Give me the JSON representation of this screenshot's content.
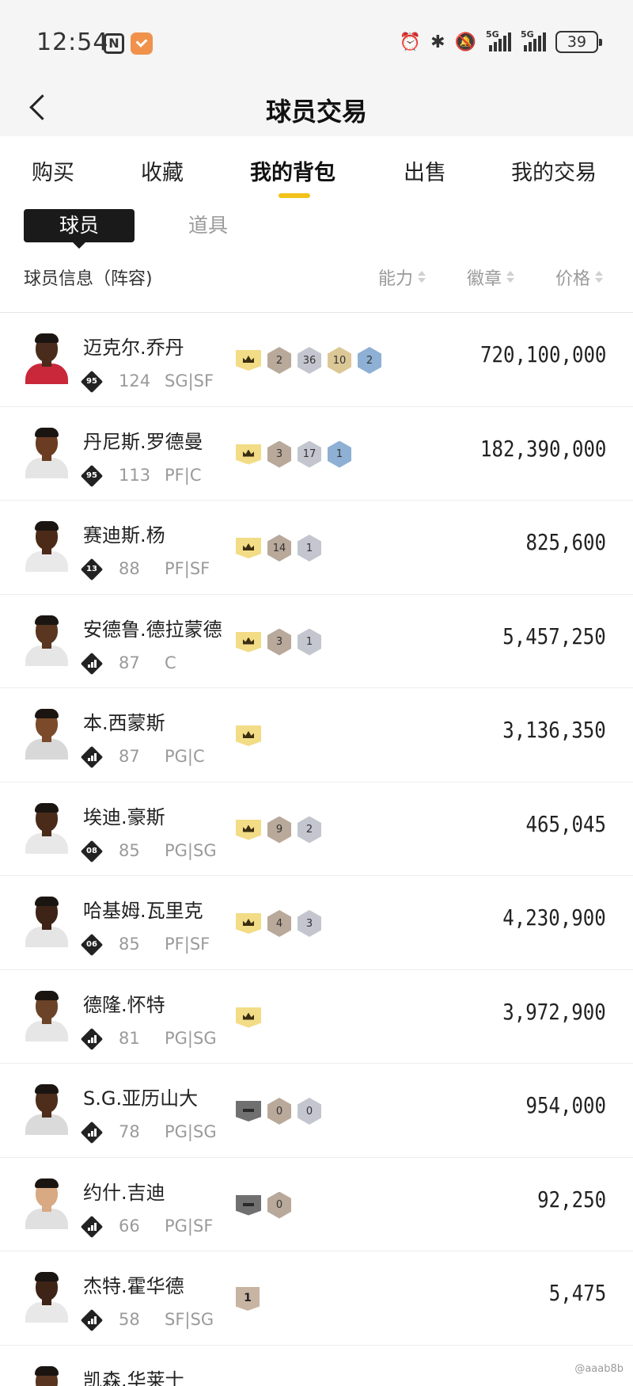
{
  "status_bar": {
    "time": "12:54",
    "nfc_label": "N",
    "battery_level": "39",
    "signal_1_label": "5G",
    "signal_2_label": "5G",
    "icons": [
      "alarm-icon",
      "bluetooth-icon",
      "mute-icon",
      "signal-icon",
      "signal-icon",
      "battery-icon"
    ]
  },
  "header": {
    "title": "球员交易"
  },
  "tabs": [
    {
      "label": "购买",
      "active": false
    },
    {
      "label": "收藏",
      "active": false
    },
    {
      "label": "我的背包",
      "active": true
    },
    {
      "label": "出售",
      "active": false
    },
    {
      "label": "我的交易",
      "active": false
    }
  ],
  "subtabs": [
    {
      "label": "球员",
      "active": true
    },
    {
      "label": "道具",
      "active": false
    }
  ],
  "columns": {
    "info": "球员信息（阵容)",
    "ability": "能力",
    "badge": "徽章",
    "price": "价格"
  },
  "players": [
    {
      "name": "迈克尔.乔丹",
      "tier": "95",
      "rating": "124",
      "position": "SG|SF",
      "badges": [
        {
          "type": "crown"
        },
        {
          "type": "brown",
          "n": "2"
        },
        {
          "type": "silver",
          "n": "36"
        },
        {
          "type": "gold",
          "n": "10"
        },
        {
          "type": "blue",
          "n": "2"
        }
      ],
      "price": "720,100,000"
    },
    {
      "name": "丹尼斯.罗德曼",
      "tier": "95",
      "rating": "113",
      "position": "PF|C",
      "badges": [
        {
          "type": "crown"
        },
        {
          "type": "brown",
          "n": "3"
        },
        {
          "type": "silver",
          "n": "17"
        },
        {
          "type": "blue",
          "n": "1"
        }
      ],
      "price": "182,390,000"
    },
    {
      "name": "赛迪斯.杨",
      "tier": "13",
      "rating": "88",
      "position": "PF|SF",
      "badges": [
        {
          "type": "crown"
        },
        {
          "type": "brown",
          "n": "14"
        },
        {
          "type": "silver",
          "n": "1"
        }
      ],
      "price": "825,600"
    },
    {
      "name": "安德鲁.德拉蒙德",
      "tier": "",
      "rating": "87",
      "position": "C",
      "badges": [
        {
          "type": "crown"
        },
        {
          "type": "brown",
          "n": "3"
        },
        {
          "type": "silver",
          "n": "1"
        }
      ],
      "price": "5,457,250"
    },
    {
      "name": "本.西蒙斯",
      "tier": "",
      "rating": "87",
      "position": "PG|C",
      "badges": [
        {
          "type": "crown"
        }
      ],
      "price": "3,136,350"
    },
    {
      "name": "埃迪.豪斯",
      "tier": "08",
      "rating": "85",
      "position": "PG|SG",
      "badges": [
        {
          "type": "crown"
        },
        {
          "type": "brown",
          "n": "9"
        },
        {
          "type": "silver",
          "n": "2"
        }
      ],
      "price": "465,045"
    },
    {
      "name": "哈基姆.瓦里克",
      "tier": "06",
      "rating": "85",
      "position": "PF|SF",
      "badges": [
        {
          "type": "crown"
        },
        {
          "type": "brown",
          "n": "4"
        },
        {
          "type": "silver",
          "n": "3"
        }
      ],
      "price": "4,230,900"
    },
    {
      "name": "德隆.怀特",
      "tier": "",
      "rating": "81",
      "position": "PG|SG",
      "badges": [
        {
          "type": "crown"
        }
      ],
      "price": "3,972,900"
    },
    {
      "name": "S.G.亚历山大",
      "tier": "",
      "rating": "78",
      "position": "PG|SG",
      "badges": [
        {
          "type": "crown-grey"
        },
        {
          "type": "brown",
          "n": "0"
        },
        {
          "type": "silver",
          "n": "0"
        }
      ],
      "price": "954,000"
    },
    {
      "name": "约什.吉迪",
      "tier": "",
      "rating": "66",
      "position": "PG|SF",
      "badges": [
        {
          "type": "crown-grey"
        },
        {
          "type": "brown",
          "n": "0"
        }
      ],
      "price": "92,250"
    },
    {
      "name": "杰特.霍华德",
      "tier": "",
      "rating": "58",
      "position": "SF|SG",
      "badges": [
        {
          "type": "rank",
          "n": "1"
        }
      ],
      "price": "5,475"
    },
    {
      "name": "凯森.华莱士",
      "tier": "",
      "rating": "",
      "position": "",
      "badges": [],
      "price": ""
    }
  ],
  "watermark": "@aaab8b",
  "colors": {
    "accent": "#f2c21a",
    "crown_gold": "#f2dc86",
    "badge_brown": "#b9a99b",
    "badge_silver": "#c4c6cf",
    "badge_gold": "#dcc796",
    "badge_blue": "#8db0d4"
  }
}
